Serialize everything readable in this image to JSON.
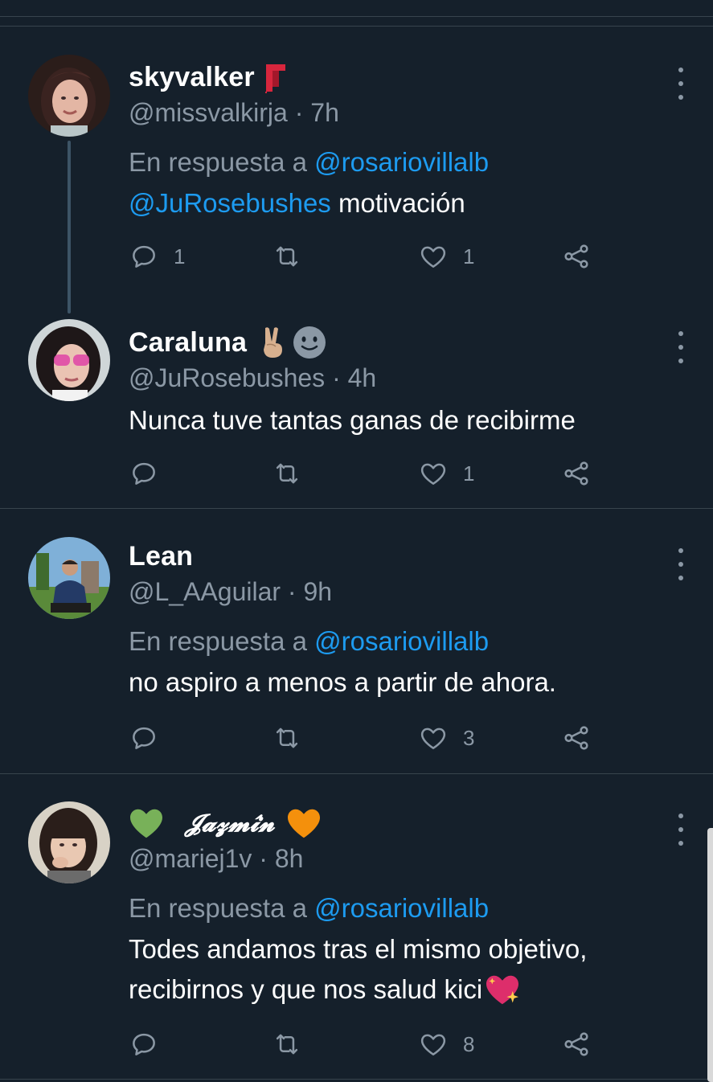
{
  "tweets": [
    {
      "display_name": "skyvalker",
      "emoji": "scarf-emoji",
      "handle": "@missvalkirja",
      "time": "· 7h",
      "reply_prefix": "En respuesta a",
      "reply_to": "@rosariovillalb",
      "body_mention": "@JuRosebushes",
      "body": " motivación",
      "reply_count": "1",
      "retweet_count": "",
      "like_count": "1"
    },
    {
      "display_name": "Caraluna",
      "emoji": "victory-hand-and-smile-emoji",
      "handle": "@JuRosebushes",
      "time": "· 4h",
      "body": "Nunca tuve tantas ganas de recibirme",
      "reply_count": "",
      "retweet_count": "",
      "like_count": "1"
    },
    {
      "display_name": "Lean",
      "handle": "@L_AAguilar",
      "time": "· 9h",
      "reply_prefix": "En respuesta a",
      "reply_to": "@rosariovillalb",
      "body": "no aspiro a menos a partir de ahora.",
      "reply_count": "",
      "retweet_count": "",
      "like_count": "3"
    },
    {
      "display_name": "𝓙𝓪𝔃𝓶𝓲́𝓷",
      "emoji": "green-heart-and-orange-heart-emoji",
      "handle": "@mariej1v",
      "time": "· 8h",
      "reply_prefix": "En respuesta a",
      "reply_to": "@rosariovillalb",
      "body_line1": "Todes andamos tras el mismo objetivo,",
      "body_line2": "recibirnos y que nos salud kici",
      "reply_count": "",
      "retweet_count": "",
      "like_count": "8"
    }
  ],
  "colors": {
    "background": "#15202b",
    "secondary_text": "#8b98a5",
    "mention": "#1d9bf0",
    "divider": "#38444d"
  }
}
